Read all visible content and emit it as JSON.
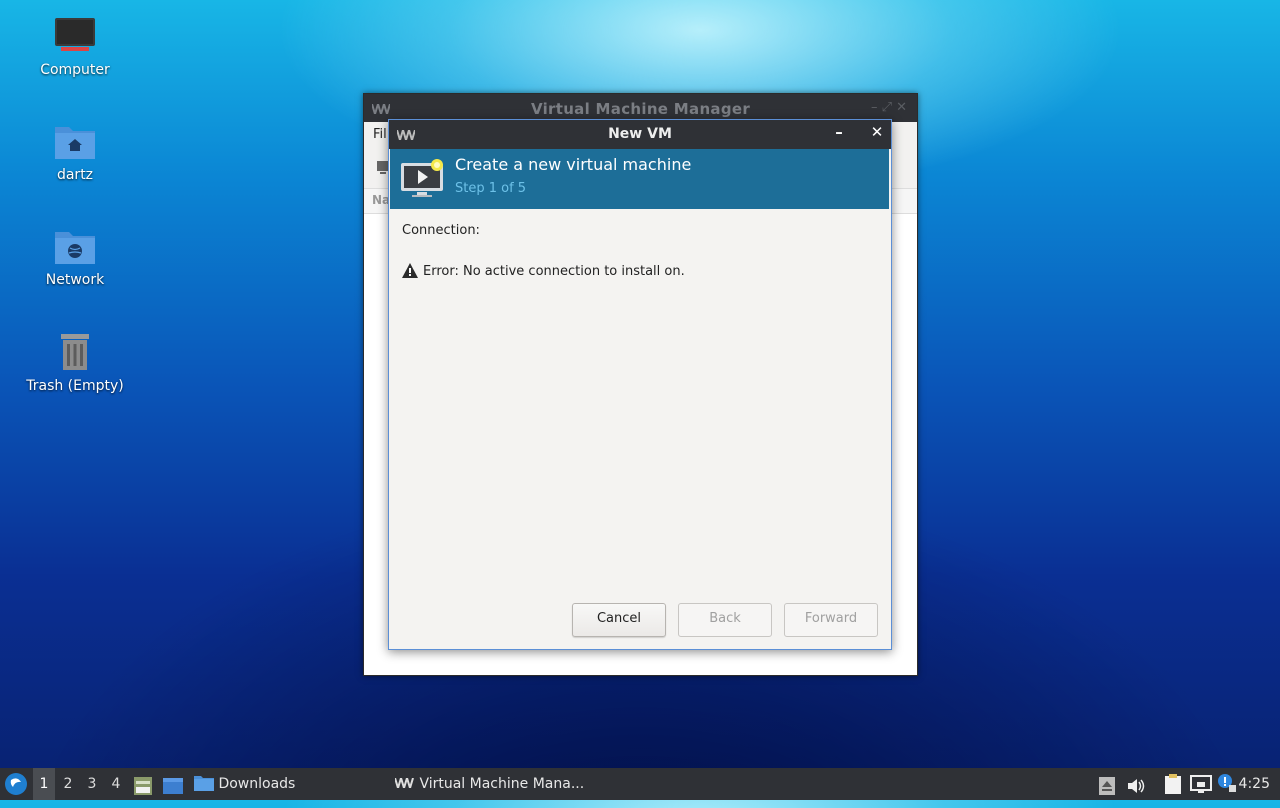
{
  "desktop": {
    "icons": [
      {
        "label": "Computer",
        "icon": "computer-icon"
      },
      {
        "label": "dartz",
        "icon": "home-folder-icon"
      },
      {
        "label": "Network",
        "icon": "network-folder-icon"
      },
      {
        "label": "Trash (Empty)",
        "icon": "trash-icon"
      }
    ]
  },
  "vmm_window": {
    "title": "Virtual Machine Manager",
    "menu_first": "Fil",
    "list_header": "Na"
  },
  "dialog": {
    "title": "New VM",
    "minimize": "–",
    "close": "✕",
    "header_title": "Create a new virtual machine",
    "header_step": "Step 1 of 5",
    "connection_label": "Connection:",
    "error_text": "Error: No active connection to install on.",
    "buttons": {
      "cancel": "Cancel",
      "back": "Back",
      "forward": "Forward"
    }
  },
  "taskbar": {
    "workspaces": [
      "1",
      "2",
      "3",
      "4"
    ],
    "active_workspace": "1",
    "tasks": [
      {
        "label": "Downloads",
        "icon": "folder-icon"
      },
      {
        "label": "Virtual Machine Mana...",
        "icon": "vmm-logo-icon"
      }
    ],
    "clock": "4:25"
  },
  "colors": {
    "header_bg": "#1d6e98",
    "titlebar_bg": "#2f3136",
    "dialog_border": "#5b8fd6"
  }
}
